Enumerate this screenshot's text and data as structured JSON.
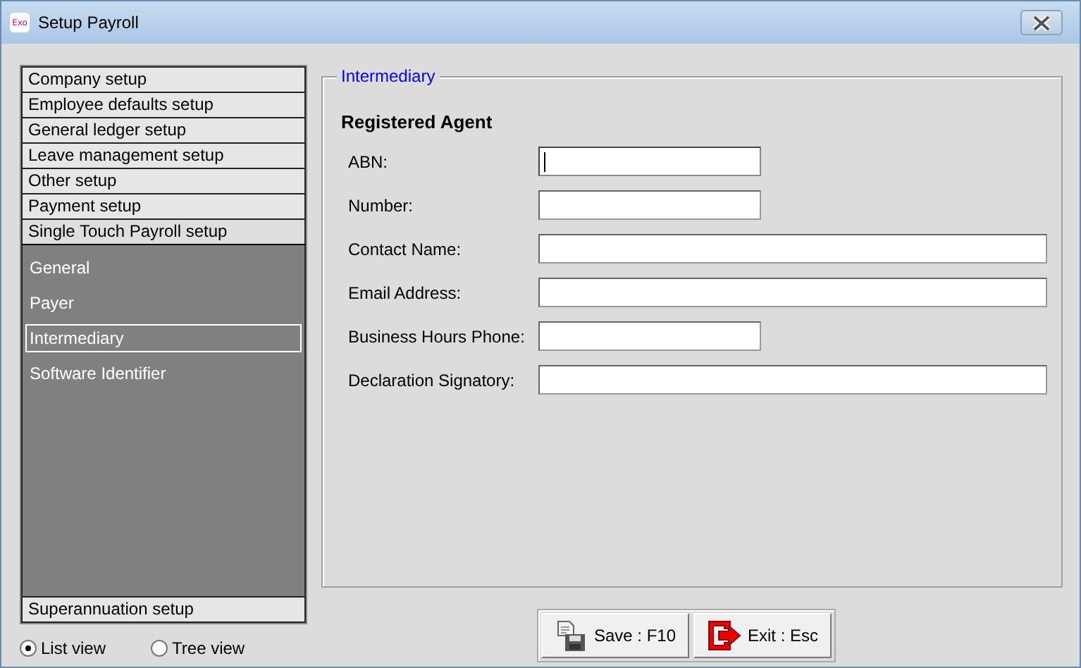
{
  "window": {
    "title": "Setup Payroll",
    "app_icon_text": "Exo"
  },
  "sidebar": {
    "sections": [
      {
        "label": "Company setup",
        "expanded": false
      },
      {
        "label": "Employee defaults setup",
        "expanded": false
      },
      {
        "label": "General ledger setup",
        "expanded": false
      },
      {
        "label": "Leave management setup",
        "expanded": false
      },
      {
        "label": "Other setup",
        "expanded": false
      },
      {
        "label": "Payment setup",
        "expanded": false
      },
      {
        "label": "Single Touch Payroll setup",
        "expanded": true,
        "children": [
          {
            "label": "General",
            "selected": false
          },
          {
            "label": "Payer",
            "selected": false
          },
          {
            "label": "Intermediary",
            "selected": true
          },
          {
            "label": "Software Identifier",
            "selected": false
          }
        ]
      },
      {
        "label": "Superannuation setup",
        "expanded": false
      }
    ]
  },
  "view_options": [
    {
      "label": "List view",
      "selected": true
    },
    {
      "label": "Tree view",
      "selected": false
    }
  ],
  "group": {
    "title": "Intermediary",
    "heading": "Registered Agent",
    "fields": [
      {
        "label": "ABN:",
        "kind": "short",
        "focused": true
      },
      {
        "label": "Number:",
        "kind": "short",
        "focused": false
      },
      {
        "label": "Contact Name:",
        "kind": "long",
        "focused": false
      },
      {
        "label": "Email Address:",
        "kind": "long",
        "focused": false
      },
      {
        "label": "Business Hours Phone:",
        "kind": "short",
        "focused": false
      },
      {
        "label": "Declaration Signatory:",
        "kind": "long",
        "focused": false
      }
    ]
  },
  "buttons": [
    {
      "label": "Save : F10",
      "kind": "save"
    },
    {
      "label": "Exit : Esc",
      "kind": "exit"
    }
  ]
}
